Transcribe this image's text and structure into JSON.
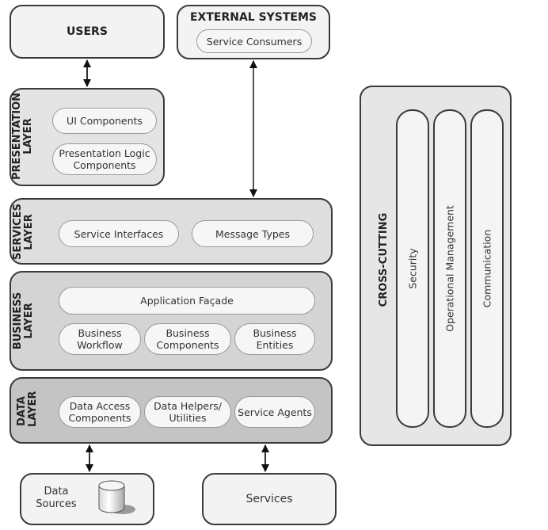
{
  "users": {
    "title": "USERS"
  },
  "external_systems": {
    "title": "EXTERNAL SYSTEMS",
    "items": [
      "Service Consumers"
    ]
  },
  "presentation_layer": {
    "label_line1": "PRESENTATION",
    "label_line2": "LAYER",
    "items": [
      "UI Components",
      "Presentation Logic Components"
    ]
  },
  "services_layer": {
    "label_line1": "SERVICES",
    "label_line2": "LAYER",
    "items": [
      "Service Interfaces",
      "Message Types"
    ]
  },
  "business_layer": {
    "label_line1": "BUSINESS",
    "label_line2": "LAYER",
    "facade": "Application Façade",
    "items": [
      "Business Workflow",
      "Business Components",
      "Business Entities"
    ]
  },
  "data_layer": {
    "label_line1": "DATA",
    "label_line2": "LAYER",
    "items": [
      "Data Access Components",
      "Data Helpers/ Utilities",
      "Service Agents"
    ]
  },
  "data_sources": {
    "title": "Data Sources",
    "icon": "database-icon"
  },
  "services": {
    "title": "Services"
  },
  "cross_cutting": {
    "title": "CROSS-CUTTING",
    "items": [
      "Security",
      "Operational Management",
      "Communication"
    ]
  },
  "colors": {
    "border": "#3a3a3a",
    "light_box": "#f3f3f3",
    "presentation_bg": "#e4e4e4",
    "services_bg": "#dedede",
    "business_bg": "#d4d4d4",
    "data_bg": "#c4c4c4",
    "pill_bg": "#f6f6f6"
  }
}
